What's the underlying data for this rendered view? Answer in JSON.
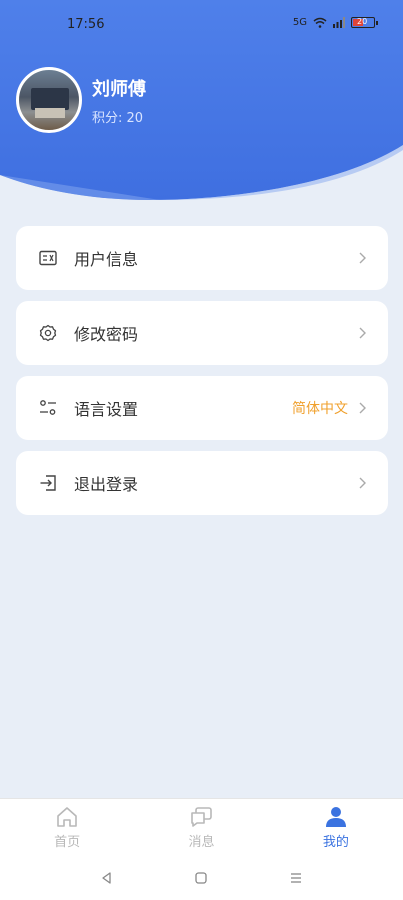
{
  "status": {
    "time": "17:56",
    "network": "5G",
    "battery": "20"
  },
  "profile": {
    "name": "刘师傅",
    "points": "积分: 20"
  },
  "menu": [
    {
      "label": "用户信息",
      "value": ""
    },
    {
      "label": "修改密码",
      "value": ""
    },
    {
      "label": "语言设置",
      "value": "简体中文"
    },
    {
      "label": "退出登录",
      "value": ""
    }
  ],
  "tabs": [
    {
      "label": "首页",
      "icon": "home-icon",
      "active": false
    },
    {
      "label": "消息",
      "icon": "message-icon",
      "active": false
    },
    {
      "label": "我的",
      "icon": "user-icon",
      "active": true
    }
  ],
  "colors": {
    "accent": "#3b73e0",
    "highlight": "#f0a02c",
    "background": "#e8eef7"
  }
}
